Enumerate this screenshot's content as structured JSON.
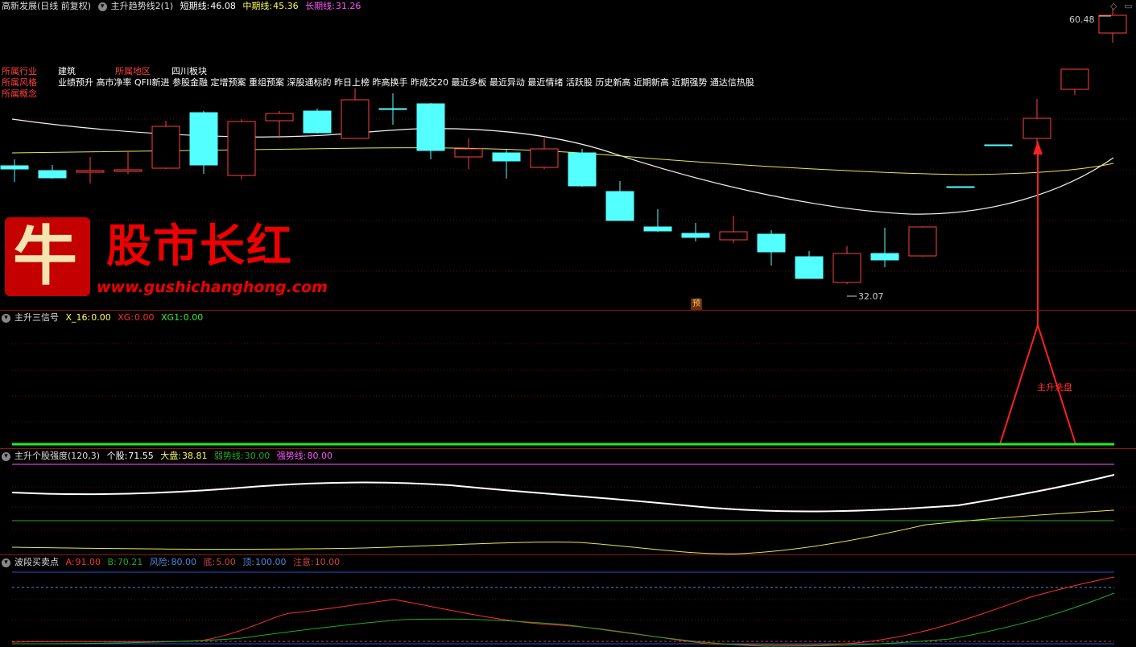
{
  "header": {
    "stock_title": "高新发展(日线 前复权)",
    "indicator_name": "主升趋势线2(1)",
    "short_label": "短期线:",
    "short_value": "46.08",
    "mid_label": "中期线:",
    "mid_value": "45.36",
    "long_label": "长期线:",
    "long_value": "31.26"
  },
  "info": {
    "industry_label": "所属行业",
    "industry_value": "建筑",
    "region_label": "所属地区",
    "region_value": "四川板块",
    "style_label": "所属风格",
    "style_value": "业绩预升 高市净率 QFII新进 参股金融 定增预案 重组预案 深股通标的 昨日上榜 昨高换手 昨成交20 最近多板 最近异动 最近情绪 活跃股 历史新高 近期新高 近期强势 通达信热股",
    "concept_label": "所属概念"
  },
  "watermark": {
    "logo_char": "牛",
    "brand_text": "股市长红",
    "url": "www.gushichanghong.com"
  },
  "price_labels": {
    "high": "60.48",
    "low": "32.07",
    "pre_marker": "预"
  },
  "panel2": {
    "title": "主升三信号",
    "x16_label": "X_16:",
    "x16_value": "0.00",
    "xg_label": "XG:",
    "xg_value": "0.00",
    "xg1_label": "XG1:",
    "xg1_value": "0.00",
    "annotation": "主升洗盘"
  },
  "panel3": {
    "title": "主升个股强度(120,3)",
    "stock_label": "个股:",
    "stock_value": "71.55",
    "market_label": "大盘:",
    "market_value": "38.81",
    "weak_label": "弱势线:",
    "weak_value": "30.00",
    "strong_label": "强势线:",
    "strong_value": "80.00"
  },
  "panel4": {
    "title": "波段买卖点",
    "a_label": "A:",
    "a_value": "91.00",
    "b_label": "B:",
    "b_value": "70.21",
    "risk_label": "风险:",
    "risk_value": "80.00",
    "bottom_label": "底:",
    "bottom_value": "5.00",
    "top_label": "顶:",
    "top_value": "100.00",
    "attention_label": "注意:",
    "attention_value": "10.00"
  },
  "colors": {
    "up": "#ff4040",
    "down": "#54ffff",
    "divider": "#8b1a1a",
    "short_line": "#ffffff",
    "mid_line": "#ffff55",
    "long_line": "#ff55ff",
    "weak_line": "#00aa00",
    "strong_line": "#ff55ff"
  }
}
